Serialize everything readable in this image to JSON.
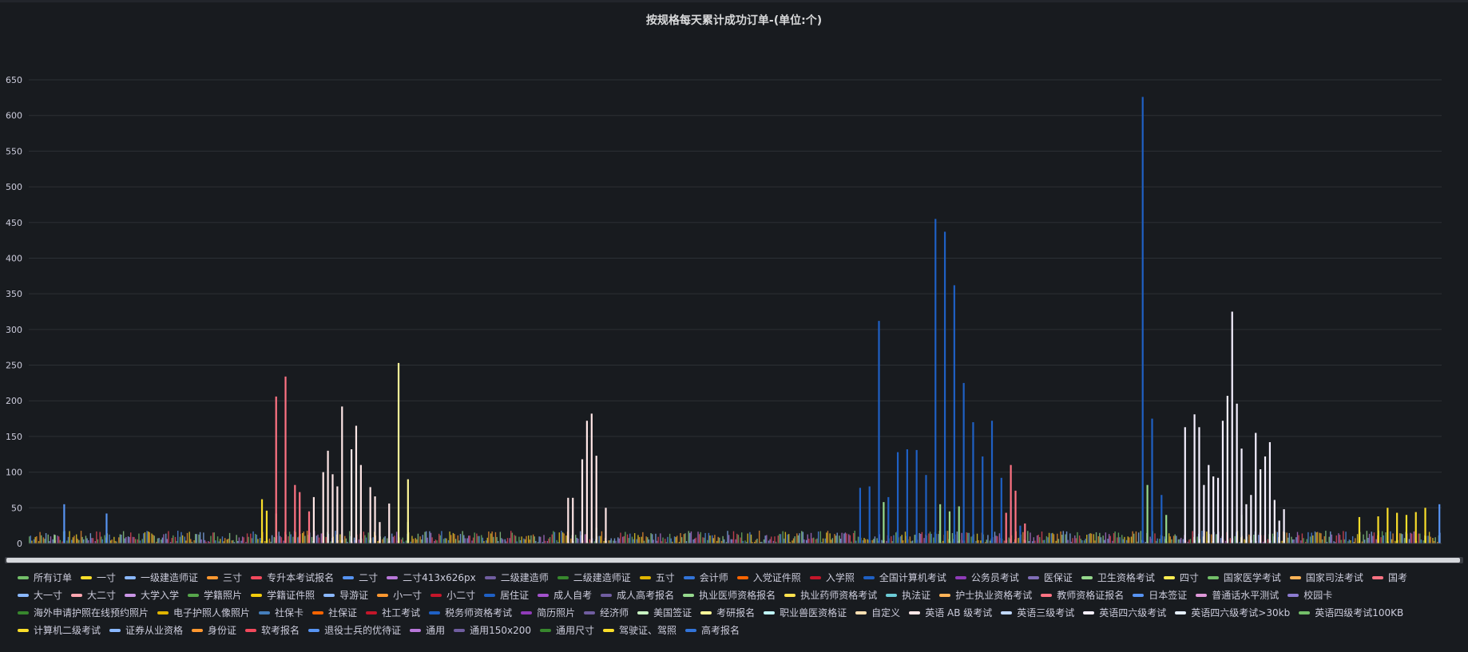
{
  "chart_data": {
    "type": "bar",
    "title": "按规格每天累计成功订单-(单位:个)",
    "ylim": [
      0,
      650
    ],
    "yticks": [
      0,
      50,
      100,
      150,
      200,
      250,
      300,
      350,
      400,
      450,
      500,
      550,
      600,
      650
    ],
    "grid": true,
    "legend_position": "bottom",
    "x_count": 300,
    "series": [
      {
        "name": "所有订单",
        "color": "#73bf69",
        "values": []
      },
      {
        "name": "一寸",
        "color": "#fade2a",
        "values": []
      },
      {
        "name": "一级建造师证",
        "color": "#8ab8ff",
        "values": []
      },
      {
        "name": "三寸",
        "color": "#ff9830",
        "values": []
      },
      {
        "name": "专升本考试报名",
        "color": "#f2495c",
        "values": []
      },
      {
        "name": "二寸",
        "color": "#5794f2",
        "values": []
      },
      {
        "name": "二寸413x626px",
        "color": "#b877d9",
        "values": []
      },
      {
        "name": "二级建造师",
        "color": "#705da0",
        "values": []
      },
      {
        "name": "二级建造师证",
        "color": "#37872d",
        "values": []
      },
      {
        "name": "五寸",
        "color": "#e0b400",
        "values": []
      },
      {
        "name": "会计师",
        "color": "#3274d9",
        "values": []
      },
      {
        "name": "入党证件照",
        "color": "#fa6400",
        "values": []
      },
      {
        "name": "入学照",
        "color": "#c4162a",
        "values": []
      },
      {
        "name": "全国计算机考试",
        "color": "#1f60c4",
        "values": [
          {
            "x": 176,
            "y": 78
          },
          {
            "x": 178,
            "y": 80
          },
          {
            "x": 180,
            "y": 312
          },
          {
            "x": 182,
            "y": 65
          },
          {
            "x": 184,
            "y": 128
          },
          {
            "x": 186,
            "y": 132
          },
          {
            "x": 188,
            "y": 131
          },
          {
            "x": 190,
            "y": 96
          },
          {
            "x": 192,
            "y": 455
          },
          {
            "x": 194,
            "y": 437
          },
          {
            "x": 196,
            "y": 362
          },
          {
            "x": 198,
            "y": 225
          },
          {
            "x": 200,
            "y": 170
          },
          {
            "x": 202,
            "y": 122
          },
          {
            "x": 204,
            "y": 172
          },
          {
            "x": 206,
            "y": 92
          },
          {
            "x": 208,
            "y": 60
          },
          {
            "x": 210,
            "y": 25
          },
          {
            "x": 236,
            "y": 626
          },
          {
            "x": 238,
            "y": 175
          },
          {
            "x": 240,
            "y": 68
          }
        ]
      },
      {
        "name": "公务员考试",
        "color": "#8f3bb8",
        "values": []
      },
      {
        "name": "医保证",
        "color": "#806eb7",
        "values": []
      },
      {
        "name": "卫生资格考试",
        "color": "#96d98d",
        "values": [
          {
            "x": 5,
            "y": 12
          },
          {
            "x": 52,
            "y": 42
          },
          {
            "x": 80,
            "y": 30
          },
          {
            "x": 120,
            "y": 22
          },
          {
            "x": 181,
            "y": 58
          },
          {
            "x": 193,
            "y": 55
          },
          {
            "x": 195,
            "y": 45
          },
          {
            "x": 197,
            "y": 52
          },
          {
            "x": 237,
            "y": 82
          },
          {
            "x": 241,
            "y": 40
          },
          {
            "x": 257,
            "y": 40
          }
        ]
      },
      {
        "name": "四寸",
        "color": "#ffee52",
        "values": []
      },
      {
        "name": "国家医学考试",
        "color": "#73bf69",
        "values": []
      },
      {
        "name": "国家司法考试",
        "color": "#ffb357",
        "values": []
      },
      {
        "name": "国考",
        "color": "#ff7383",
        "values": [
          {
            "x": 52,
            "y": 206
          },
          {
            "x": 54,
            "y": 234
          },
          {
            "x": 56,
            "y": 82
          },
          {
            "x": 57,
            "y": 72
          },
          {
            "x": 59,
            "y": 45
          },
          {
            "x": 207,
            "y": 43
          },
          {
            "x": 208,
            "y": 110
          },
          {
            "x": 209,
            "y": 74
          },
          {
            "x": 211,
            "y": 28
          }
        ]
      },
      {
        "name": "大一寸",
        "color": "#8ab8ff",
        "values": []
      },
      {
        "name": "大二寸",
        "color": "#ffa6b0",
        "values": []
      },
      {
        "name": "大学入学",
        "color": "#ca95e5",
        "values": []
      },
      {
        "name": "学籍照片",
        "color": "#56a64b",
        "values": []
      },
      {
        "name": "学籍证件照",
        "color": "#f2cc0c",
        "values": []
      },
      {
        "name": "导游证",
        "color": "#8ab8ff",
        "values": []
      },
      {
        "name": "小一寸",
        "color": "#ff9830",
        "values": []
      },
      {
        "name": "小二寸",
        "color": "#c4162a",
        "values": []
      },
      {
        "name": "居住证",
        "color": "#1f60c4",
        "values": []
      },
      {
        "name": "成人自考",
        "color": "#a352cc",
        "values": []
      },
      {
        "name": "成人高考报名",
        "color": "#705da0",
        "values": []
      },
      {
        "name": "执业医师资格报名",
        "color": "#96d98d",
        "values": []
      },
      {
        "name": "执业药师资格考试",
        "color": "#ffe14d",
        "values": []
      },
      {
        "name": "执法证",
        "color": "#6ccbd6",
        "values": []
      },
      {
        "name": "护士执业资格考试",
        "color": "#ffb357",
        "values": []
      },
      {
        "name": "教师资格证报名",
        "color": "#ff7383",
        "values": []
      },
      {
        "name": "日本签证",
        "color": "#5794f2",
        "values": []
      },
      {
        "name": "普通话水平测试",
        "color": "#de97d8",
        "values": []
      },
      {
        "name": "校园卡",
        "color": "#8c7bd0",
        "values": []
      },
      {
        "name": "海外申请护照在线预约照片",
        "color": "#37872d",
        "values": []
      },
      {
        "name": "电子护照人像照片",
        "color": "#e0b400",
        "values": []
      },
      {
        "name": "社保卡",
        "color": "#447ebc",
        "values": []
      },
      {
        "name": "社保证",
        "color": "#fa6400",
        "values": []
      },
      {
        "name": "社工考试",
        "color": "#c4162a",
        "values": []
      },
      {
        "name": "税务师资格考试",
        "color": "#1f60c4",
        "values": []
      },
      {
        "name": "简历照片",
        "color": "#8f3bb8",
        "values": []
      },
      {
        "name": "经济师",
        "color": "#705da0",
        "values": []
      },
      {
        "name": "美国签证",
        "color": "#c8f2c2",
        "values": []
      },
      {
        "name": "考研报名",
        "color": "#fff899",
        "values": [
          {
            "x": 78,
            "y": 253
          },
          {
            "x": 80,
            "y": 90
          }
        ]
      },
      {
        "name": "职业兽医资格证",
        "color": "#c0f6fa",
        "values": []
      },
      {
        "name": "自定义",
        "color": "#ffe0b2",
        "values": []
      },
      {
        "name": "英语 AB 级考试",
        "color": "#ffe6e6",
        "values": [
          {
            "x": 60,
            "y": 65
          },
          {
            "x": 62,
            "y": 100
          },
          {
            "x": 63,
            "y": 130
          },
          {
            "x": 64,
            "y": 97
          },
          {
            "x": 65,
            "y": 80
          },
          {
            "x": 66,
            "y": 192
          },
          {
            "x": 68,
            "y": 132
          },
          {
            "x": 69,
            "y": 165
          },
          {
            "x": 70,
            "y": 110
          },
          {
            "x": 72,
            "y": 79
          },
          {
            "x": 73,
            "y": 66
          },
          {
            "x": 74,
            "y": 30
          },
          {
            "x": 76,
            "y": 56
          },
          {
            "x": 114,
            "y": 64
          },
          {
            "x": 115,
            "y": 64
          },
          {
            "x": 117,
            "y": 118
          },
          {
            "x": 118,
            "y": 172
          },
          {
            "x": 119,
            "y": 182
          },
          {
            "x": 120,
            "y": 123
          },
          {
            "x": 122,
            "y": 50
          }
        ]
      },
      {
        "name": "英语三级考试",
        "color": "#c0d8ff",
        "values": []
      },
      {
        "name": "英语四六级考试",
        "color": "#f5f0ff",
        "values": [
          {
            "x": 245,
            "y": 163
          },
          {
            "x": 247,
            "y": 181
          },
          {
            "x": 248,
            "y": 163
          },
          {
            "x": 249,
            "y": 82
          },
          {
            "x": 250,
            "y": 110
          },
          {
            "x": 251,
            "y": 94
          },
          {
            "x": 252,
            "y": 92
          },
          {
            "x": 253,
            "y": 172
          },
          {
            "x": 254,
            "y": 207
          },
          {
            "x": 255,
            "y": 325
          },
          {
            "x": 256,
            "y": 196
          },
          {
            "x": 257,
            "y": 133
          },
          {
            "x": 258,
            "y": 55
          },
          {
            "x": 259,
            "y": 68
          },
          {
            "x": 260,
            "y": 155
          },
          {
            "x": 261,
            "y": 104
          },
          {
            "x": 262,
            "y": 122
          },
          {
            "x": 263,
            "y": 142
          },
          {
            "x": 264,
            "y": 61
          },
          {
            "x": 265,
            "y": 32
          },
          {
            "x": 266,
            "y": 48
          }
        ]
      },
      {
        "name": "英语四六级考试>30kb",
        "color": "#e6f0ff",
        "values": []
      },
      {
        "name": "英语四级考试100KB",
        "color": "#73bf69",
        "values": []
      },
      {
        "name": "计算机二级考试",
        "color": "#fade2a",
        "values": [
          {
            "x": 49,
            "y": 62
          },
          {
            "x": 50,
            "y": 46
          },
          {
            "x": 282,
            "y": 37
          },
          {
            "x": 286,
            "y": 38
          },
          {
            "x": 288,
            "y": 50
          },
          {
            "x": 290,
            "y": 43
          },
          {
            "x": 292,
            "y": 40
          },
          {
            "x": 294,
            "y": 44
          },
          {
            "x": 296,
            "y": 50
          }
        ]
      },
      {
        "name": "证券从业资格",
        "color": "#8ab8ff",
        "values": []
      },
      {
        "name": "身份证",
        "color": "#ff9830",
        "values": []
      },
      {
        "name": "软考报名",
        "color": "#f2495c",
        "values": []
      },
      {
        "name": "退役士兵的优待证",
        "color": "#5794f2",
        "values": [
          {
            "x": 7,
            "y": 55
          },
          {
            "x": 16,
            "y": 42
          },
          {
            "x": 299,
            "y": 55
          }
        ]
      },
      {
        "name": "通用",
        "color": "#b877d9",
        "values": []
      },
      {
        "name": "通用150x200",
        "color": "#705da0",
        "values": []
      },
      {
        "name": "通用尺寸",
        "color": "#37872d",
        "values": []
      },
      {
        "name": "驾驶证、驾照",
        "color": "#fade2a",
        "values": []
      },
      {
        "name": "高考报名",
        "color": "#3274d9",
        "values": []
      }
    ]
  }
}
